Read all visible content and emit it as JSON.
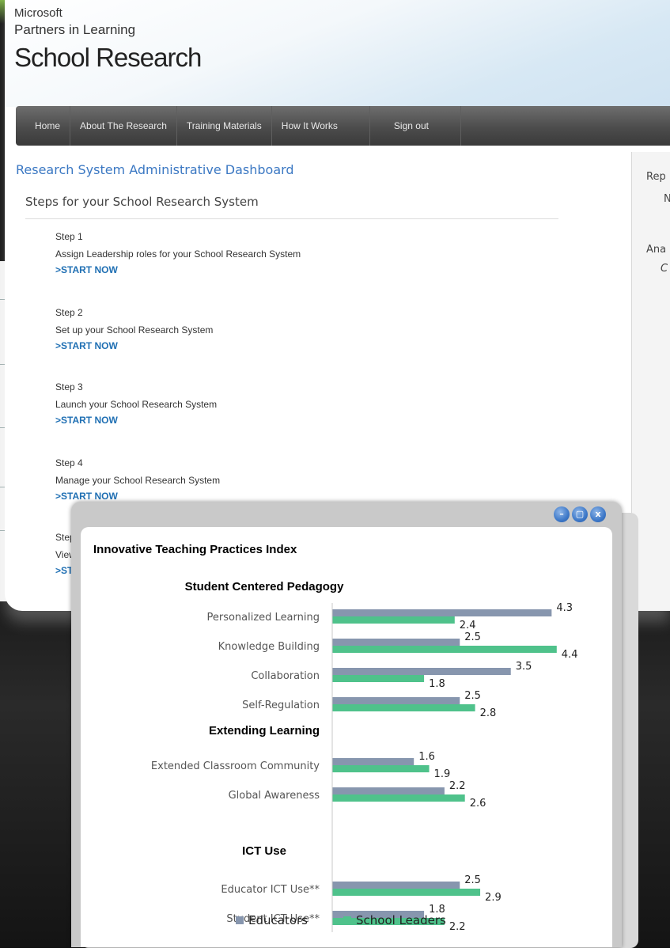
{
  "header": {
    "brand_line1": "Microsoft",
    "brand_line2": "Partners in Learning",
    "site_title": "School Research"
  },
  "nav": {
    "items": [
      "Home",
      "About The Research",
      "Training Materials",
      "How It Works",
      "Sign out"
    ]
  },
  "main": {
    "dashboard_title": "Research System Administrative Dashboard",
    "steps_heading": "Steps for your School Research System",
    "steps": [
      {
        "num": "Step 1",
        "desc": "Assign Leadership roles for your School Research System",
        "link": ">START NOW"
      },
      {
        "num": "Step 2",
        "desc": "Set up your School Research System",
        "link": ">START NOW"
      },
      {
        "num": "Step 3",
        "desc": "Launch your School Research System",
        "link": ">START NOW"
      },
      {
        "num": "Step 4",
        "desc": "Manage your School Research System",
        "link": ">START NOW"
      },
      {
        "num": "Step",
        "desc": "View",
        "link": ">ST"
      }
    ]
  },
  "right_column": {
    "label1": "Rep",
    "label1_sub": "N",
    "label2": "Ana",
    "label2_sub": "C"
  },
  "popup": {
    "buttons": [
      "–",
      "▢",
      "x"
    ],
    "button_color": "#3d78c8"
  },
  "chart_data": {
    "type": "bar",
    "orientation": "horizontal",
    "title": "Innovative Teaching Practices Index",
    "groups": [
      {
        "heading": "Student Centered Pedagogy",
        "categories": [
          "Personalized Learning",
          "Knowledge Building",
          "Collaboration",
          "Self-Regulation"
        ]
      },
      {
        "heading": "Extending Learning",
        "categories": [
          "Extended Classroom Community",
          "Global Awareness"
        ]
      },
      {
        "heading": "ICT Use",
        "categories": [
          "Educator ICT Use**",
          "Student ICT Use**"
        ]
      }
    ],
    "series": [
      {
        "name": "Educators",
        "color": "#8796ae",
        "values": [
          4.3,
          2.5,
          3.5,
          2.5,
          1.6,
          2.2,
          2.5,
          1.8
        ]
      },
      {
        "name": "School Leaders",
        "color": "#4fc28b",
        "values": [
          2.4,
          4.4,
          1.8,
          2.8,
          1.9,
          2.6,
          2.9,
          2.2
        ]
      }
    ],
    "xlim": [
      0,
      5
    ],
    "grid": false,
    "legend_position": "bottom"
  }
}
